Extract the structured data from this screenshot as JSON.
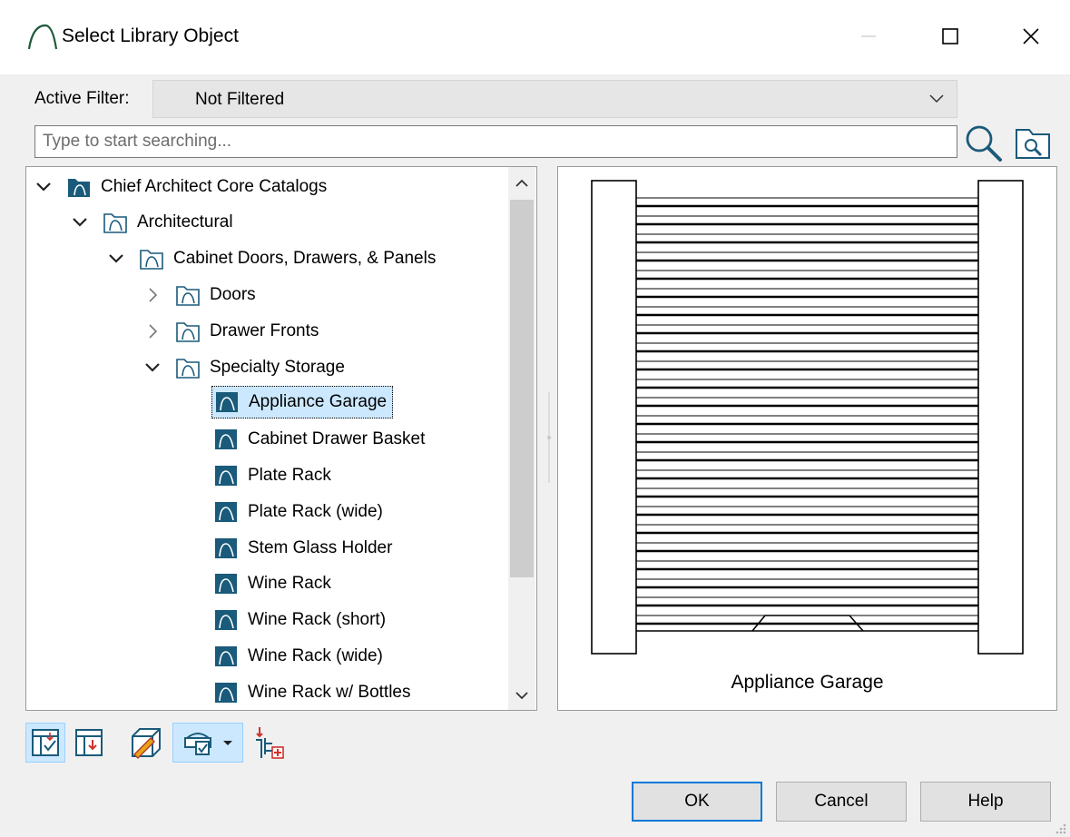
{
  "window": {
    "title": "Select Library Object"
  },
  "filter": {
    "label": "Active Filter:",
    "value": "Not Filtered"
  },
  "search": {
    "placeholder": "Type to start searching..."
  },
  "tree": {
    "items": [
      {
        "label": "Chief Architect Core Catalogs",
        "expanded": true,
        "icon": "catalog-folder-icon"
      },
      {
        "label": "Architectural",
        "expanded": true,
        "icon": "folder-icon"
      },
      {
        "label": "Cabinet Doors, Drawers, & Panels",
        "expanded": true,
        "icon": "folder-icon"
      },
      {
        "label": "Doors",
        "expanded": false,
        "icon": "folder-icon"
      },
      {
        "label": "Drawer Fronts",
        "expanded": false,
        "icon": "folder-icon"
      },
      {
        "label": "Specialty Storage",
        "expanded": true,
        "icon": "folder-icon"
      },
      {
        "label": "Appliance Garage",
        "selected": true,
        "icon": "library-object-icon"
      },
      {
        "label": "Cabinet Drawer Basket",
        "icon": "library-object-icon"
      },
      {
        "label": "Plate Rack",
        "icon": "library-object-icon"
      },
      {
        "label": "Plate Rack (wide)",
        "icon": "library-object-icon"
      },
      {
        "label": "Stem Glass Holder",
        "icon": "library-object-icon"
      },
      {
        "label": "Wine Rack",
        "icon": "library-object-icon"
      },
      {
        "label": "Wine Rack (short)",
        "icon": "library-object-icon"
      },
      {
        "label": "Wine Rack (wide)",
        "icon": "library-object-icon"
      },
      {
        "label": "Wine Rack w/ Bottles",
        "icon": "library-object-icon"
      }
    ]
  },
  "preview": {
    "caption": "Appliance Garage"
  },
  "toolbar": {
    "icons": [
      "show-filtered-icon",
      "sort-tree-icon",
      "material-icon",
      "view-options-icon",
      "add-to-library-icon"
    ]
  },
  "buttons": {
    "ok": "OK",
    "cancel": "Cancel",
    "help": "Help"
  },
  "colors": {
    "accent": "#0078d7",
    "selection": "#cce8ff",
    "icon_blue": "#1a5a7a"
  }
}
